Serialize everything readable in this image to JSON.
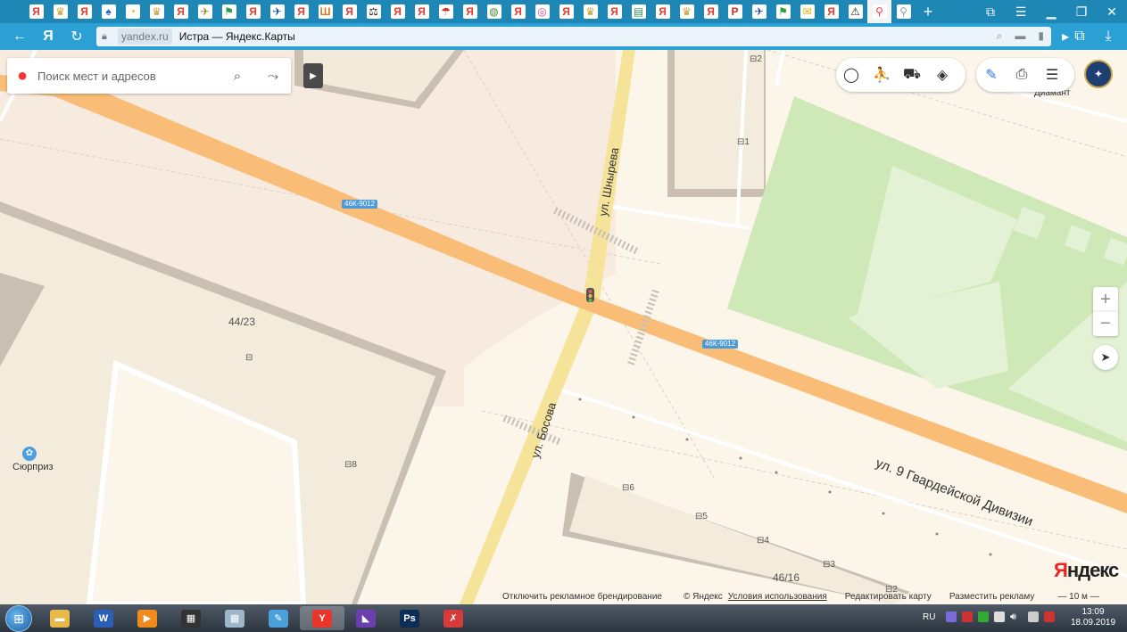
{
  "browser": {
    "tabs": [
      {
        "icon": "panel-icon",
        "glyph": "▭",
        "color": "#1f87b6"
      },
      {
        "icon": "yandex-tab-icon",
        "glyph": "Я",
        "color": "#e63b2e"
      },
      {
        "icon": "emblem-tab-icon",
        "glyph": "♛",
        "color": "#c7a23a"
      },
      {
        "icon": "yandex-tab-icon",
        "glyph": "Я",
        "color": "#e63b2e"
      },
      {
        "icon": "tree-tab-icon",
        "glyph": "♠",
        "color": "#2a62c9"
      },
      {
        "icon": "pacman-tab-icon",
        "glyph": "◔",
        "color": "#f4a900"
      },
      {
        "icon": "emblem-tab-icon",
        "glyph": "♛",
        "color": "#c7a23a"
      },
      {
        "icon": "yandex-tab-icon",
        "glyph": "Я",
        "color": "#e63b2e"
      },
      {
        "icon": "plane-tab-icon",
        "glyph": "✈",
        "color": "#a08520"
      },
      {
        "icon": "gosuslugi-tab-icon",
        "glyph": "⚑",
        "color": "#2e9c45"
      },
      {
        "icon": "yandex-tab-icon",
        "glyph": "Я",
        "color": "#e63b2e"
      },
      {
        "icon": "plane-tab-icon",
        "glyph": "✈",
        "color": "#1d4fa8"
      },
      {
        "icon": "yandex-tab-icon",
        "glyph": "Я",
        "color": "#e63b2e"
      },
      {
        "icon": "book-tab-icon",
        "glyph": "Ш",
        "color": "#d9781c"
      },
      {
        "icon": "yandex-tab-icon",
        "glyph": "Я",
        "color": "#e63b2e"
      },
      {
        "icon": "scales-tab-icon",
        "glyph": "⚖",
        "color": "#222222"
      },
      {
        "icon": "yandex-tab-icon",
        "glyph": "Я",
        "color": "#e63b2e"
      },
      {
        "icon": "yandex-tab-icon",
        "glyph": "Я",
        "color": "#e63b2e"
      },
      {
        "icon": "umbrella-tab-icon",
        "glyph": "☂",
        "color": "#d52d2d"
      },
      {
        "icon": "yandex-tab-icon",
        "glyph": "Я",
        "color": "#e63b2e"
      },
      {
        "icon": "circle-logo-tab-icon",
        "glyph": "◍",
        "color": "#4b8c3c"
      },
      {
        "icon": "yandex-tab-icon",
        "glyph": "Я",
        "color": "#e63b2e"
      },
      {
        "icon": "globe-tab-icon",
        "glyph": "◎",
        "color": "#d64a8a"
      },
      {
        "icon": "yandex-tab-icon",
        "glyph": "Я",
        "color": "#e63b2e"
      },
      {
        "icon": "emblem-tab-icon",
        "glyph": "♛",
        "color": "#c7a23a"
      },
      {
        "icon": "yandex-tab-icon",
        "glyph": "Я",
        "color": "#e63b2e"
      },
      {
        "icon": "document-tab-icon",
        "glyph": "▤",
        "color": "#3a8f66"
      },
      {
        "icon": "yandex-tab-icon",
        "glyph": "Я",
        "color": "#e63b2e"
      },
      {
        "icon": "emblem-tab-icon",
        "glyph": "♛",
        "color": "#c7a23a"
      },
      {
        "icon": "yandex-tab-icon",
        "glyph": "Я",
        "color": "#e63b2e"
      },
      {
        "icon": "parking-tab-icon",
        "glyph": "P",
        "color": "#d22c2c"
      },
      {
        "icon": "plane-tab-icon",
        "glyph": "✈",
        "color": "#1d4fa8"
      },
      {
        "icon": "gosuslugi-tab-icon",
        "glyph": "⚑",
        "color": "#2e9c45"
      },
      {
        "icon": "mail-tab-icon",
        "glyph": "✉",
        "color": "#f0a800"
      },
      {
        "icon": "yandex-tab-icon",
        "glyph": "Я",
        "color": "#e63b2e"
      },
      {
        "icon": "warning-tab-icon",
        "glyph": "⚠",
        "color": "#222222"
      },
      {
        "icon": "yandex-maps-tab-icon",
        "glyph": "⚲",
        "color": "#f33",
        "active": true
      },
      {
        "icon": "pin-tab-icon",
        "glyph": "⚲",
        "color": "#7fa6b8"
      }
    ],
    "address": {
      "domain": "yandex.ru",
      "title": "Истра — Яндекс.Карты"
    }
  },
  "search": {
    "placeholder": "Поиск мест и адресов"
  },
  "map": {
    "road_badges": [
      "46К-9012",
      "46К-9012"
    ],
    "streets": {
      "main": "ул. 9 Гвардейской Дивизии",
      "north": "ул. Шнырева",
      "south": "ул. Босова"
    },
    "buildings": {
      "b1": "44/23",
      "b2": "46/16",
      "e1": "2",
      "e2": "1",
      "e3": "8",
      "e4": "6",
      "e5": "5",
      "e6": "4",
      "e7": "3",
      "e8": "2"
    },
    "poi": {
      "surprise": "Сюрприз",
      "diamant": "Диамант"
    }
  },
  "controls": {
    "zoom_in": "+",
    "zoom_out": "−"
  },
  "footer": {
    "disable_ads": "Отключить рекламное брендирование",
    "copyright": "© Яндекс",
    "terms": "Условия использования",
    "edit_map": "Редактировать карту",
    "place_ad": "Разместить рекламу",
    "scale": "10 м",
    "logo_first": "Я",
    "logo_rest": "ндекс"
  },
  "taskbar": {
    "apps": [
      {
        "icon": "file-explorer-icon",
        "label": "▬",
        "color": "#e8b948"
      },
      {
        "icon": "word-icon",
        "label": "W",
        "color": "#2b5eb7"
      },
      {
        "icon": "media-player-icon",
        "label": "▶",
        "color": "#f08a1a"
      },
      {
        "icon": "video-editor-icon",
        "label": "▦",
        "color": "#333333"
      },
      {
        "icon": "calculator-icon",
        "label": "▦",
        "color": "#9db7c9"
      },
      {
        "icon": "paint-icon",
        "label": "✎",
        "color": "#4aa0d8"
      },
      {
        "icon": "yandex-browser-icon",
        "label": "Y",
        "color": "#e8362a",
        "active": true
      },
      {
        "icon": "visual-studio-icon",
        "label": "◣",
        "color": "#6c3fb0"
      },
      {
        "icon": "photoshop-icon",
        "label": "Ps",
        "color": "#0c2d56"
      },
      {
        "icon": "pdf-editor-icon",
        "label": "✗",
        "color": "#d63a3a"
      }
    ],
    "lang": "RU",
    "time": "13:09",
    "date": "18.09.2019"
  },
  "colors": {
    "main_road": "#f9bd78",
    "secondary_road": "#f6e39a",
    "park": "#cfe8b7",
    "building": "#f2ead9",
    "building_shadow": "#c7bfb1"
  }
}
